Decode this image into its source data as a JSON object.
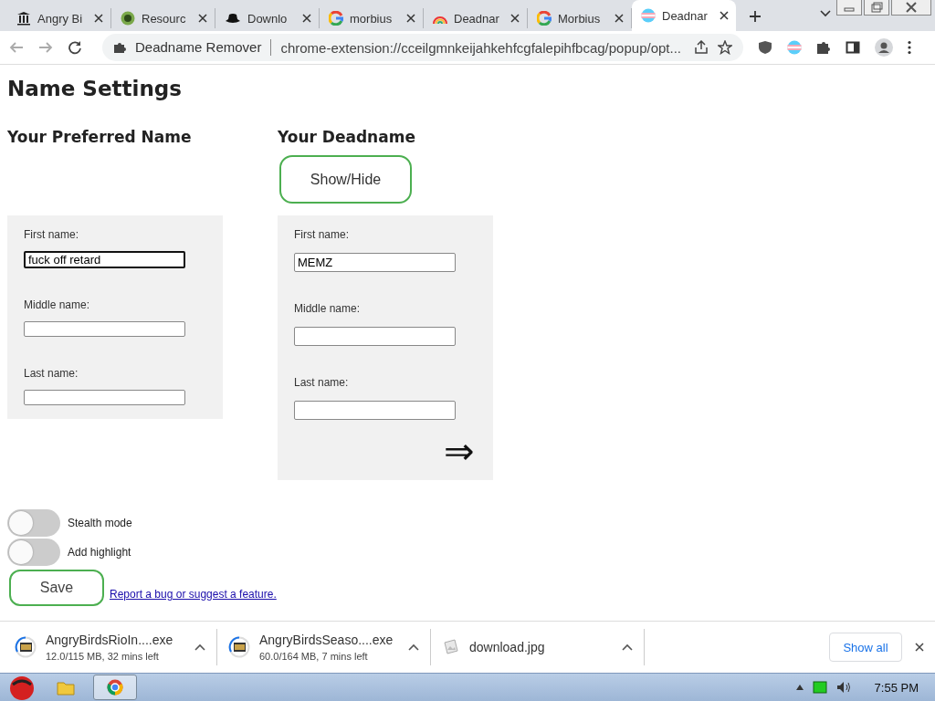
{
  "tabs": [
    {
      "title": "Angry Bi",
      "kind": "columns",
      "selected": false
    },
    {
      "title": "Resourc",
      "kind": "badge",
      "selected": false
    },
    {
      "title": "Downlo",
      "kind": "hat",
      "selected": false
    },
    {
      "title": "morbius",
      "kind": "ring",
      "selected": false
    },
    {
      "title": "Deadnar",
      "kind": "rainbow",
      "selected": false
    },
    {
      "title": "Morbius",
      "kind": "ring",
      "selected": false
    },
    {
      "title": "Deadnar",
      "kind": "flag",
      "selected": true
    }
  ],
  "address_bar": {
    "site_name": "Deadname Remover",
    "url": "chrome-extension://cceilgmnkeijahkehfcgfalepihfbcag/popup/opt..."
  },
  "page": {
    "title": "Name Settings",
    "preferred": {
      "heading": "Your Preferred Name",
      "fields": [
        {
          "label": "First name:",
          "value": "fuck off retard",
          "focused": true
        },
        {
          "label": "Middle name:",
          "focused": false
        },
        {
          "label": "Last name:",
          "focused": false
        }
      ]
    },
    "deadname": {
      "heading": "Your Deadname",
      "show_hide": "Show/Hide",
      "fields": [
        {
          "label": "First name:",
          "value": "MEMZ",
          "focused": false
        },
        {
          "label": "Middle name:",
          "focused": false
        },
        {
          "label": "Last name:",
          "focused": false
        }
      ],
      "arrow": "⇒"
    },
    "toggles": [
      {
        "label": "Stealth mode",
        "on": false
      },
      {
        "label": "Add highlight",
        "on": false
      }
    ],
    "save": "Save",
    "link": "Report a bug or suggest a feature."
  },
  "downloads": {
    "items": [
      {
        "name": "AngryBirdsRioIn....exe",
        "status": "12.0/115 MB, 32 mins left",
        "kind": "installer"
      },
      {
        "name": "AngryBirdsSeaso....exe",
        "status": "60.0/164 MB, 7 mins left",
        "kind": "installer"
      },
      {
        "name": "download.jpg",
        "kind": "image"
      }
    ],
    "show_all": "Show all"
  },
  "taskbar": {
    "clock": "7:55 PM"
  }
}
